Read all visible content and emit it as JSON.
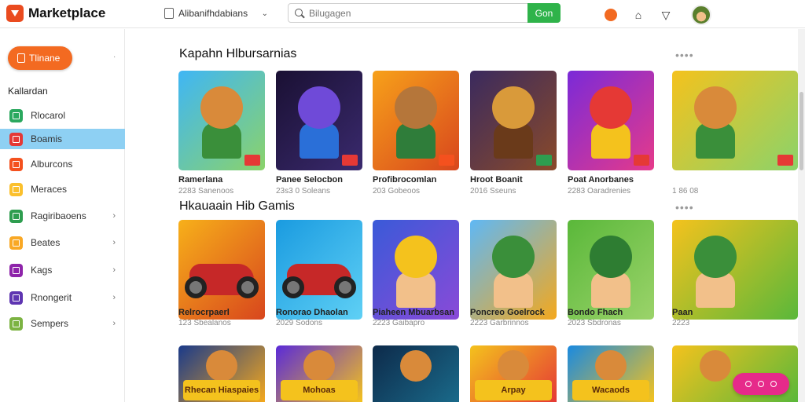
{
  "app": {
    "title": "Marketplace",
    "brand_color": "#ea4b1f"
  },
  "header": {
    "picker_label": "Alibanifhdabians",
    "search_placeholder": "Bilugagen",
    "search_button": "Gon",
    "icons": [
      "orange-circle-icon",
      "bag-icon",
      "trophy-icon"
    ]
  },
  "sidebar": {
    "cta_label": "Tlinane",
    "heading": "Kallardan",
    "items": [
      {
        "label": "Rlocarol",
        "color": "#2aa85e",
        "active": false,
        "chevron": false
      },
      {
        "label": "Boamis",
        "color": "#e53935",
        "active": true,
        "chevron": false
      },
      {
        "label": "Alburcons",
        "color": "#f4511e",
        "active": false,
        "chevron": false
      },
      {
        "label": "Meraces",
        "color": "#fbc02d",
        "active": false,
        "chevron": false
      },
      {
        "label": "Ragiribaoens",
        "color": "#2e9d4f",
        "active": false,
        "chevron": true
      },
      {
        "label": "Beates",
        "color": "#f9a825",
        "active": false,
        "chevron": true
      },
      {
        "label": "Kags",
        "color": "#8e24aa",
        "active": false,
        "chevron": true
      },
      {
        "label": "Rnongerit",
        "color": "#5e35b1",
        "active": false,
        "chevron": true
      },
      {
        "label": "Sempers",
        "color": "#7cb342",
        "active": false,
        "chevron": true
      }
    ]
  },
  "sections": [
    {
      "title": "Kapahn Hlbursarnias",
      "more": "••••",
      "games": [
        {
          "title": "Ramerlana",
          "sub": "2283 Sanenoos"
        },
        {
          "title": "Panee Selocbon",
          "sub": "23s3 0 Soleans"
        },
        {
          "title": "Profibrocomlan",
          "sub": "203 Gobeoos"
        },
        {
          "title": "Hroot Boanit",
          "sub": "2016 Sseuns"
        },
        {
          "title": "Poat Anorbanes",
          "sub": "2283 Oaradrenies"
        },
        {
          "title": "",
          "sub": "1 86 08"
        }
      ]
    },
    {
      "title": "Hkauaain Hib Gamis",
      "more": "••••",
      "games": [
        {
          "title": "Relrocrpaerl",
          "sub": "123 Sbealanos"
        },
        {
          "title": "Ronorao Dhaolan",
          "sub": "2029 Sodons"
        },
        {
          "title": "Piaheen Mbuarbsan",
          "sub": "2223 Gaibapro"
        },
        {
          "title": "Poncreo Goelrock",
          "sub": "2223 Garbrinnos"
        },
        {
          "title": "Bondo Fhach",
          "sub": "2023 Sbdronas"
        },
        {
          "title": "Paan",
          "sub": "2223"
        }
      ]
    }
  ],
  "third_row": [
    "Rhecan Hiaspaies",
    "Mohoas",
    "",
    "Arpay",
    "Wacaods",
    ""
  ]
}
